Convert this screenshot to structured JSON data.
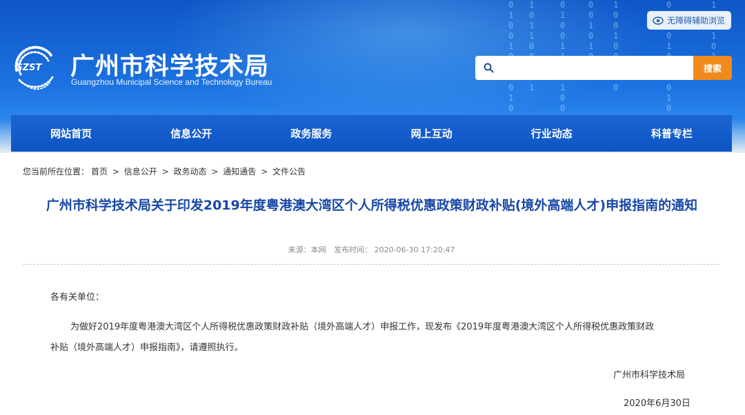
{
  "header": {
    "logo_mark_text": "GZST",
    "title": "广州市科学技术局",
    "subtitle": "Guangzhou Municipal Science and Technology Bureau",
    "accessibility_label": "无障碍辅助浏览",
    "search_placeholder": "",
    "search_button": "搜索"
  },
  "nav": {
    "items": [
      "网站首页",
      "信息公开",
      "政务服务",
      "网上互动",
      "行业动态",
      "科普专栏"
    ]
  },
  "breadcrumb": {
    "prefix": "您当前所在位置：",
    "items": [
      "首页",
      "信息公开",
      "政务动态",
      "通知通告",
      "文件公告"
    ],
    "separator": ">"
  },
  "article": {
    "title": "广州市科学技术局关于印发2019年度粤港澳大湾区个人所得税优惠政策财政补贴(境外高端人才)申报指南的通知",
    "source": "来源：本网",
    "publish_time": "发布时间： 2020-06-30 17:20:47",
    "salutation": "各有关单位：",
    "body_line1": "为做好2019年度粤港澳大湾区个人所得税优惠政策财政补贴（境外高端人才）申报工作，现发布《2019年度粤港澳大湾区个人所得税优惠政策财政",
    "body_line2": "补贴（境外高端人才）申报指南》，请遵照执行。",
    "signature": "广州市科学技术局",
    "date": "2020年6月30日"
  },
  "colors": {
    "header_blue": "#1b72e0",
    "nav_blue": "#0e55c4",
    "title_blue": "#1747a6",
    "search_orange": "#f08a1c"
  }
}
